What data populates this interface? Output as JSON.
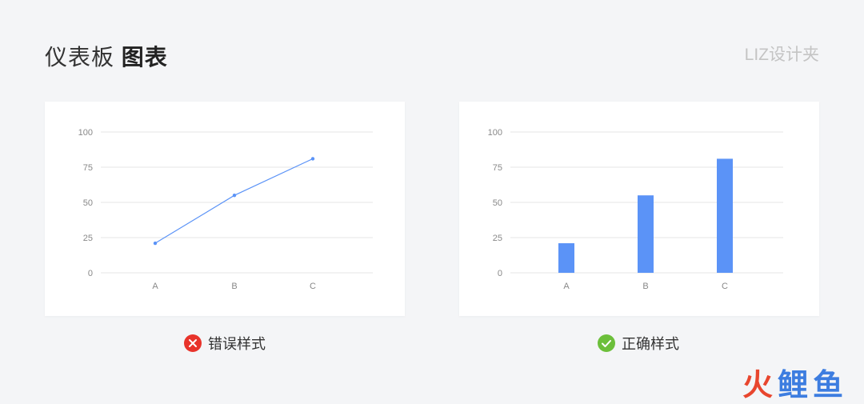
{
  "header": {
    "title_prefix": "仪表板",
    "title_bold": "图表",
    "brand": "LIZ设计夹"
  },
  "captions": {
    "wrong": "错误样式",
    "right": "正确样式"
  },
  "watermark": {
    "char1": "火",
    "char2": "鲤",
    "char3": "鱼"
  },
  "colors": {
    "series": "#5b93f7",
    "line": "#5b93f7",
    "error_badge": "#e8332b",
    "success_badge": "#6cbf3b"
  },
  "chart_data": [
    {
      "type": "line",
      "categories": [
        "A",
        "B",
        "C"
      ],
      "values": [
        21,
        55,
        81
      ],
      "ylim": [
        0,
        100
      ],
      "yticks": [
        0,
        25,
        50,
        75,
        100
      ],
      "grid": true
    },
    {
      "type": "bar",
      "categories": [
        "A",
        "B",
        "C"
      ],
      "values": [
        21,
        55,
        81
      ],
      "ylim": [
        0,
        100
      ],
      "yticks": [
        0,
        25,
        50,
        75,
        100
      ],
      "grid": true
    }
  ]
}
